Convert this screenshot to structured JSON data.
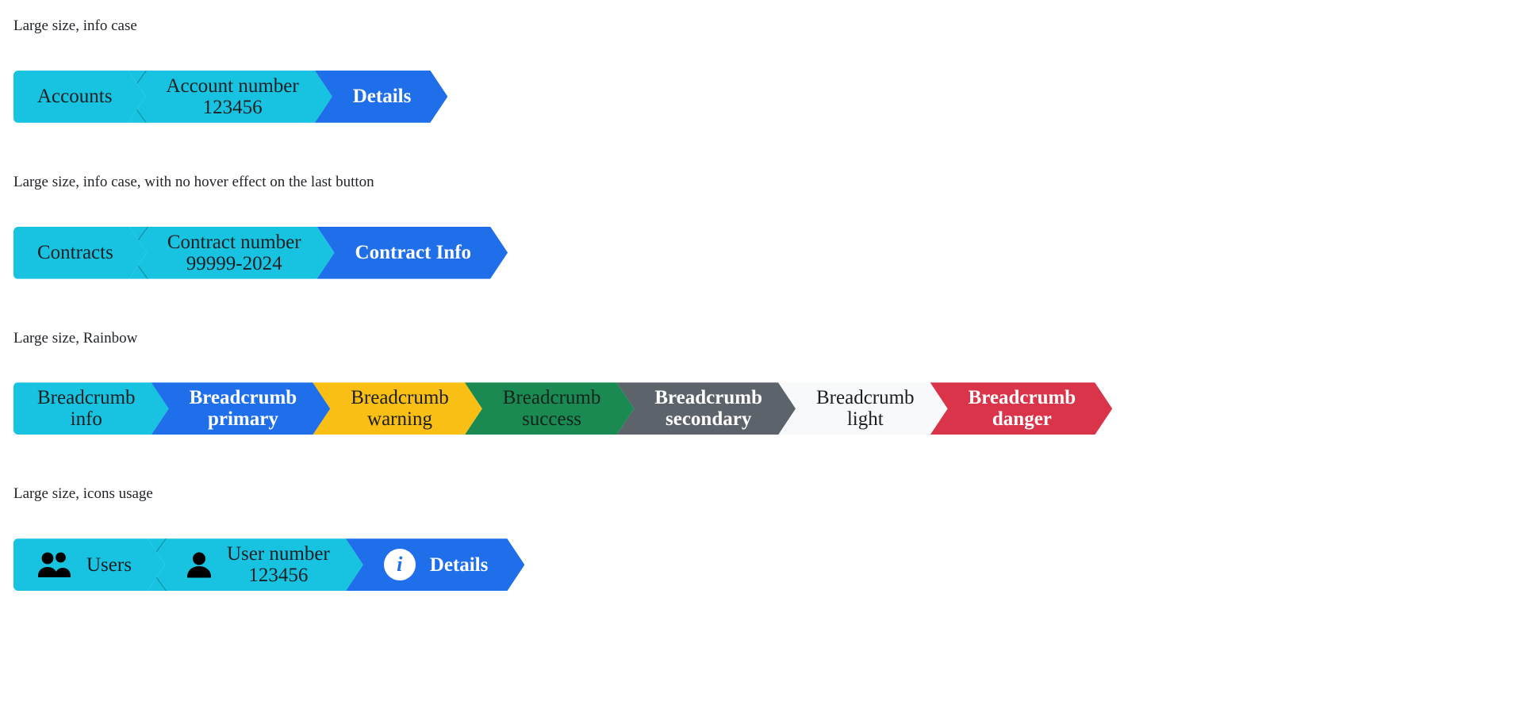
{
  "page": {
    "background": "#ffffff"
  },
  "palette": {
    "info": "#17c3e0",
    "primary": "#1f6feb",
    "warning": "#f9bf15",
    "success": "#1a8a52",
    "secondary": "#5c636a",
    "light": "#f8f9fa",
    "danger": "#d93449",
    "dark_text": "#1b1f22",
    "light_text": "#ffffff"
  },
  "sections": [
    {
      "title": "Large size, info case",
      "breadcrumb": {
        "items": [
          {
            "label_lines": [
              "Accounts"
            ],
            "variant": "info",
            "icon": null
          },
          {
            "label_lines": [
              "Account number",
              "123456"
            ],
            "variant": "info",
            "icon": null
          },
          {
            "label_lines": [
              "Details"
            ],
            "variant": "primary",
            "icon": null
          }
        ],
        "last_shape": "arrow"
      }
    },
    {
      "title": "Large size, info case, with no hover effect on the last button",
      "breadcrumb": {
        "items": [
          {
            "label_lines": [
              "Contracts"
            ],
            "variant": "info",
            "icon": null
          },
          {
            "label_lines": [
              "Contract number",
              "99999-2024"
            ],
            "variant": "info",
            "icon": null
          },
          {
            "label_lines": [
              "Contract Info"
            ],
            "variant": "primary",
            "icon": null
          }
        ],
        "last_shape": "arrow"
      }
    },
    {
      "title": "Large size, Rainbow",
      "breadcrumb": {
        "items": [
          {
            "label_lines": [
              "Breadcrumb",
              "info"
            ],
            "variant": "info",
            "icon": null
          },
          {
            "label_lines": [
              "Breadcrumb",
              "primary"
            ],
            "variant": "primary",
            "icon": null
          },
          {
            "label_lines": [
              "Breadcrumb",
              "warning"
            ],
            "variant": "warning",
            "icon": null
          },
          {
            "label_lines": [
              "Breadcrumb",
              "success"
            ],
            "variant": "success",
            "icon": null
          },
          {
            "label_lines": [
              "Breadcrumb",
              "secondary"
            ],
            "variant": "secondary",
            "icon": null
          },
          {
            "label_lines": [
              "Breadcrumb",
              "light"
            ],
            "variant": "light",
            "icon": null
          },
          {
            "label_lines": [
              "Breadcrumb",
              "danger"
            ],
            "variant": "danger",
            "icon": null
          }
        ],
        "last_shape": "arrow"
      }
    },
    {
      "title": "Large size, icons usage",
      "breadcrumb": {
        "items": [
          {
            "label_lines": [
              "Users"
            ],
            "variant": "info",
            "icon": "users-icon"
          },
          {
            "label_lines": [
              "User number",
              "123456"
            ],
            "variant": "info",
            "icon": "user-icon"
          },
          {
            "label_lines": [
              "Details"
            ],
            "variant": "primary",
            "icon": "info-circle-icon"
          }
        ],
        "last_shape": "arrow"
      }
    }
  ]
}
